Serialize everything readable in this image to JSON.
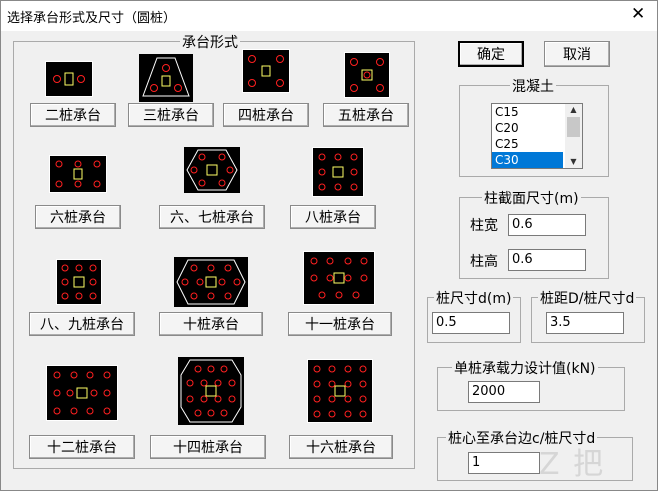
{
  "window": {
    "title": "选择承台形式及尺寸（圆桩）"
  },
  "dialog": {
    "ok_label": "确定",
    "cancel_label": "取消"
  },
  "cap_group": {
    "legend": "承台形式",
    "buttons": [
      "二桩承台",
      "三桩承台",
      "四桩承台",
      "五桩承台",
      "六桩承台",
      "六、七桩承台",
      "八桩承台",
      "八、九桩承台",
      "十桩承台",
      "十一桩承台",
      "十二桩承台",
      "十四桩承台",
      "十六桩承台"
    ]
  },
  "concrete": {
    "legend": "混凝土",
    "items": [
      "C15",
      "C20",
      "C25",
      "C30"
    ],
    "selected": "C30"
  },
  "pile_section": {
    "legend": "柱截面尺寸(m)",
    "width_label": "柱宽",
    "width_value": "0.6",
    "height_label": "柱高",
    "height_value": "0.6"
  },
  "pile_size": {
    "legend": "桩尺寸d(m)",
    "value": "0.5"
  },
  "pile_spacing": {
    "legend": "桩距D/桩尺寸d",
    "value": "3.5"
  },
  "pile_capacity": {
    "legend": "单桩承载力设计值(kN)",
    "value": "2000"
  },
  "pile_edge": {
    "legend": "桩心至承台边c/桩尺寸d",
    "value": "1"
  },
  "colors": {
    "pile": "#ff2020",
    "column": "#ffff66",
    "cap": "#000000",
    "selection": "#0078d7"
  }
}
